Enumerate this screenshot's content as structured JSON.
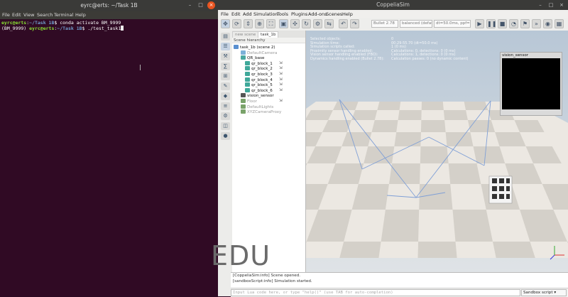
{
  "terminal": {
    "title": "eyrc@erts: ~/Task 1B",
    "menu": [
      "File",
      "Edit",
      "View",
      "Search",
      "Terminal",
      "Help"
    ],
    "lines": [
      {
        "prefix": "",
        "user": "eyrc@erts",
        "path": "~/Task 1B",
        "cmd": "$ conda activate BM_9999"
      },
      {
        "prefix": "(BM_9999) ",
        "user": "eyrc@erts",
        "path": "~/Task 1B",
        "cmd": "$ ./test_task1"
      }
    ]
  },
  "coppelia": {
    "title": "CoppeliaSim",
    "menu": [
      "File",
      "Edit",
      "Add",
      "Simulation",
      "Tools",
      "Plugins",
      "Add-ons",
      "Scenes",
      "Help"
    ],
    "toolbar": {
      "engine": "Bullet 2.78",
      "precision": "balanced (defau",
      "timestep": "dt=50.0ms, ppf=1"
    },
    "tabs": [
      "new scene",
      "task_1b"
    ],
    "hierarchy": {
      "header": "Scene hierarchy",
      "items": [
        {
          "label": "task_1b (scene 2)",
          "dim": false
        },
        {
          "label": "DefaultCamera",
          "dim": true
        },
        {
          "label": "QR_base",
          "dim": false
        },
        {
          "label": "qr_block_1",
          "dim": false
        },
        {
          "label": "qr_block_2",
          "dim": false
        },
        {
          "label": "qr_block_3",
          "dim": false
        },
        {
          "label": "qr_block_4",
          "dim": false
        },
        {
          "label": "qr_block_5",
          "dim": false
        },
        {
          "label": "qr_block_6",
          "dim": false
        },
        {
          "label": "vision_sensor",
          "dim": false
        },
        {
          "label": "Floor",
          "dim": true
        },
        {
          "label": "DefaultLights",
          "dim": true
        },
        {
          "label": "XYZCameraProxy",
          "dim": true
        }
      ]
    },
    "info": {
      "labels": [
        "Selected objects:",
        "Simulation time:",
        "Simulation scripts called:",
        "Proximity sensor handling enabled:",
        "Vision sensor handling enabled (FBO):",
        "Dynamics handling enabled (Bullet 2.78):"
      ],
      "values": [
        "0",
        "00:29:55.70 (dt=50.0 ms)",
        "1 (0 ms)",
        "Calculations: 0, detections: 0 (0 ms)",
        "Calculations: 1, detections: 0 (0 ms)",
        "Calculation passes: 0 (no dynamic content)"
      ]
    },
    "vision_sensor_label": "vision_sensor",
    "watermark": "EDU",
    "console": [
      "[CoppeliaSim:info] Scene opened.",
      "[sandboxScript:info] Simulation started."
    ],
    "command_placeholder": "Input Lua code here, or type \"help()\" (use TAB for auto-completion)",
    "script_select": "Sandbox script"
  },
  "colors": {
    "terminal_bg": "#300a24",
    "prompt_user": "#8ae234",
    "prompt_path": "#729fcf",
    "sensor_lines": "#7f9fd6"
  }
}
